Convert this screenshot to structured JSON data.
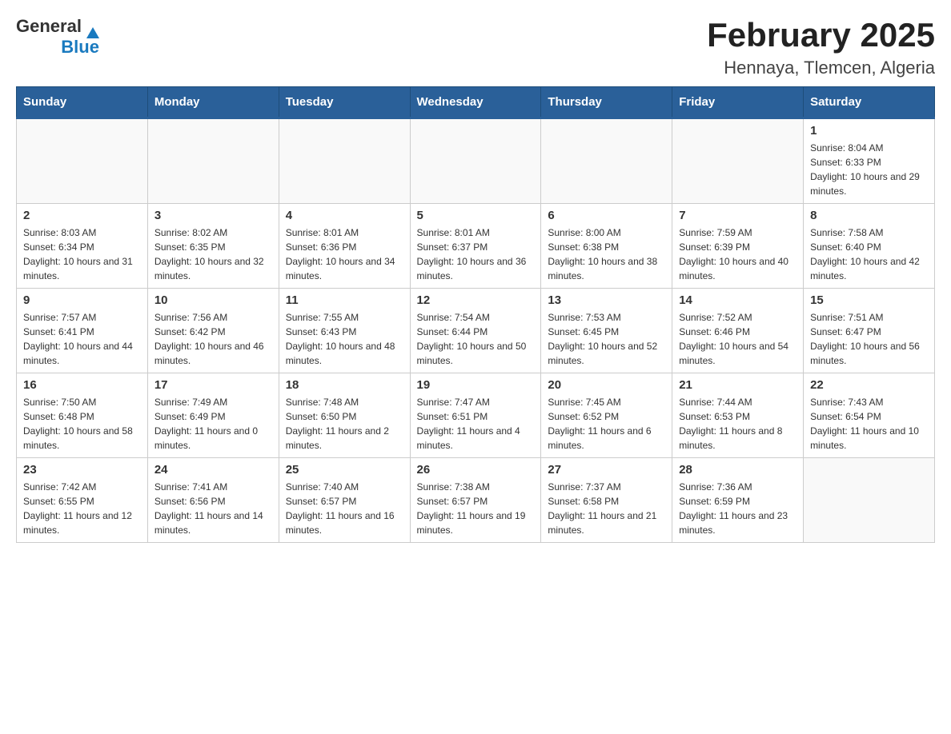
{
  "header": {
    "title": "February 2025",
    "subtitle": "Hennaya, Tlemcen, Algeria",
    "logo_general": "General",
    "logo_blue": "Blue"
  },
  "days_of_week": [
    "Sunday",
    "Monday",
    "Tuesday",
    "Wednesday",
    "Thursday",
    "Friday",
    "Saturday"
  ],
  "weeks": [
    [
      {
        "day": "",
        "info": ""
      },
      {
        "day": "",
        "info": ""
      },
      {
        "day": "",
        "info": ""
      },
      {
        "day": "",
        "info": ""
      },
      {
        "day": "",
        "info": ""
      },
      {
        "day": "",
        "info": ""
      },
      {
        "day": "1",
        "info": "Sunrise: 8:04 AM\nSunset: 6:33 PM\nDaylight: 10 hours and 29 minutes."
      }
    ],
    [
      {
        "day": "2",
        "info": "Sunrise: 8:03 AM\nSunset: 6:34 PM\nDaylight: 10 hours and 31 minutes."
      },
      {
        "day": "3",
        "info": "Sunrise: 8:02 AM\nSunset: 6:35 PM\nDaylight: 10 hours and 32 minutes."
      },
      {
        "day": "4",
        "info": "Sunrise: 8:01 AM\nSunset: 6:36 PM\nDaylight: 10 hours and 34 minutes."
      },
      {
        "day": "5",
        "info": "Sunrise: 8:01 AM\nSunset: 6:37 PM\nDaylight: 10 hours and 36 minutes."
      },
      {
        "day": "6",
        "info": "Sunrise: 8:00 AM\nSunset: 6:38 PM\nDaylight: 10 hours and 38 minutes."
      },
      {
        "day": "7",
        "info": "Sunrise: 7:59 AM\nSunset: 6:39 PM\nDaylight: 10 hours and 40 minutes."
      },
      {
        "day": "8",
        "info": "Sunrise: 7:58 AM\nSunset: 6:40 PM\nDaylight: 10 hours and 42 minutes."
      }
    ],
    [
      {
        "day": "9",
        "info": "Sunrise: 7:57 AM\nSunset: 6:41 PM\nDaylight: 10 hours and 44 minutes."
      },
      {
        "day": "10",
        "info": "Sunrise: 7:56 AM\nSunset: 6:42 PM\nDaylight: 10 hours and 46 minutes."
      },
      {
        "day": "11",
        "info": "Sunrise: 7:55 AM\nSunset: 6:43 PM\nDaylight: 10 hours and 48 minutes."
      },
      {
        "day": "12",
        "info": "Sunrise: 7:54 AM\nSunset: 6:44 PM\nDaylight: 10 hours and 50 minutes."
      },
      {
        "day": "13",
        "info": "Sunrise: 7:53 AM\nSunset: 6:45 PM\nDaylight: 10 hours and 52 minutes."
      },
      {
        "day": "14",
        "info": "Sunrise: 7:52 AM\nSunset: 6:46 PM\nDaylight: 10 hours and 54 minutes."
      },
      {
        "day": "15",
        "info": "Sunrise: 7:51 AM\nSunset: 6:47 PM\nDaylight: 10 hours and 56 minutes."
      }
    ],
    [
      {
        "day": "16",
        "info": "Sunrise: 7:50 AM\nSunset: 6:48 PM\nDaylight: 10 hours and 58 minutes."
      },
      {
        "day": "17",
        "info": "Sunrise: 7:49 AM\nSunset: 6:49 PM\nDaylight: 11 hours and 0 minutes."
      },
      {
        "day": "18",
        "info": "Sunrise: 7:48 AM\nSunset: 6:50 PM\nDaylight: 11 hours and 2 minutes."
      },
      {
        "day": "19",
        "info": "Sunrise: 7:47 AM\nSunset: 6:51 PM\nDaylight: 11 hours and 4 minutes."
      },
      {
        "day": "20",
        "info": "Sunrise: 7:45 AM\nSunset: 6:52 PM\nDaylight: 11 hours and 6 minutes."
      },
      {
        "day": "21",
        "info": "Sunrise: 7:44 AM\nSunset: 6:53 PM\nDaylight: 11 hours and 8 minutes."
      },
      {
        "day": "22",
        "info": "Sunrise: 7:43 AM\nSunset: 6:54 PM\nDaylight: 11 hours and 10 minutes."
      }
    ],
    [
      {
        "day": "23",
        "info": "Sunrise: 7:42 AM\nSunset: 6:55 PM\nDaylight: 11 hours and 12 minutes."
      },
      {
        "day": "24",
        "info": "Sunrise: 7:41 AM\nSunset: 6:56 PM\nDaylight: 11 hours and 14 minutes."
      },
      {
        "day": "25",
        "info": "Sunrise: 7:40 AM\nSunset: 6:57 PM\nDaylight: 11 hours and 16 minutes."
      },
      {
        "day": "26",
        "info": "Sunrise: 7:38 AM\nSunset: 6:57 PM\nDaylight: 11 hours and 19 minutes."
      },
      {
        "day": "27",
        "info": "Sunrise: 7:37 AM\nSunset: 6:58 PM\nDaylight: 11 hours and 21 minutes."
      },
      {
        "day": "28",
        "info": "Sunrise: 7:36 AM\nSunset: 6:59 PM\nDaylight: 11 hours and 23 minutes."
      },
      {
        "day": "",
        "info": ""
      }
    ]
  ]
}
